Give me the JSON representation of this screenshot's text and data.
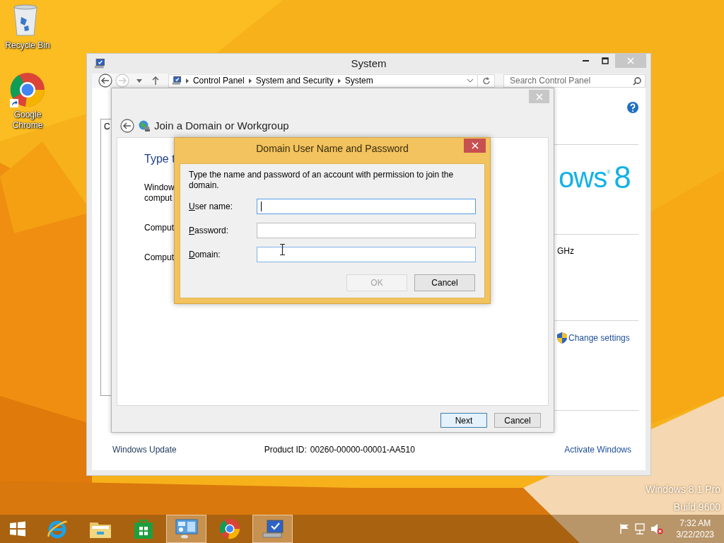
{
  "desktop": {
    "icons": [
      {
        "kind": "recycle-bin",
        "label": "Recycle Bin",
        "shortcut": false
      },
      {
        "kind": "chrome",
        "label": "Google Chrome",
        "shortcut": true
      }
    ],
    "watermark": [
      "Windows 8.1 Pro",
      "Build 9600"
    ]
  },
  "system_window": {
    "title": "System",
    "breadcrumb": [
      "Control Panel",
      "System and Security",
      "System"
    ],
    "search": {
      "placeholder": "Search Control Panel"
    },
    "left_pane": {
      "text": "C"
    },
    "logo": {
      "word": "ows",
      "mark": "®",
      "number": "8"
    },
    "processor": "GHz",
    "change_settings": "Change settings",
    "see_also": "Windows Update",
    "product_id": {
      "label": "Product ID:",
      "value": "00260-00000-00001-AA510"
    },
    "activate": "Activate Windows"
  },
  "wizard": {
    "title": "Join a Domain or Workgroup",
    "heading": "Type t",
    "paragraphs": [
      [
        "Window",
        "comput"
      ],
      [
        "Comput"
      ],
      [
        "Comput"
      ]
    ],
    "buttons": [
      {
        "label": "Next",
        "default": true
      },
      {
        "label": "Cancel",
        "default": false
      }
    ]
  },
  "dialog": {
    "title": "Domain User Name and Password",
    "instruction": "Type the name and password of an account with permission to join the domain.",
    "fields": [
      {
        "label": "User name:",
        "focused": true,
        "hovered": false
      },
      {
        "label": "Password:",
        "focused": false,
        "hovered": false
      },
      {
        "label": "Domain:",
        "focused": false,
        "hovered": true
      }
    ],
    "buttons": [
      {
        "label": "OK",
        "disabled": true
      },
      {
        "label": "Cancel",
        "disabled": false
      }
    ]
  },
  "taskbar": {
    "apps": [
      {
        "kind": "start",
        "open": false
      },
      {
        "kind": "ie",
        "open": false
      },
      {
        "kind": "explorer",
        "open": false
      },
      {
        "kind": "store",
        "open": false
      },
      {
        "kind": "control-panel",
        "open": true
      },
      {
        "kind": "chrome",
        "open": false
      },
      {
        "kind": "system",
        "open": true
      }
    ],
    "tray": [
      {
        "kind": "flag"
      },
      {
        "kind": "network"
      },
      {
        "kind": "volume-muted"
      }
    ],
    "clock": {
      "time": "7:32 AM",
      "date": "3/22/2023"
    }
  }
}
